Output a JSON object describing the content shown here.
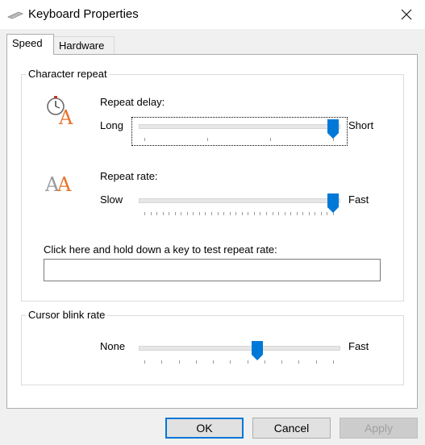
{
  "window": {
    "title": "Keyboard Properties"
  },
  "tabs": [
    {
      "label": "Speed",
      "active": true
    },
    {
      "label": "Hardware",
      "active": false
    }
  ],
  "character_repeat": {
    "group_label": "Character repeat",
    "repeat_delay": {
      "label": "Repeat delay:",
      "min_label": "Long",
      "max_label": "Short",
      "value_fraction": 1.0,
      "tick_count": 4
    },
    "repeat_rate": {
      "label": "Repeat rate:",
      "min_label": "Slow",
      "max_label": "Fast",
      "value_fraction": 1.0,
      "tick_count": 32
    },
    "test_prompt": "Click here and hold down a key to test repeat rate:",
    "test_input_value": ""
  },
  "cursor_blink": {
    "group_label": "Cursor blink rate",
    "min_label": "None",
    "max_label": "Fast",
    "value_fraction": 0.6,
    "tick_count": 12
  },
  "buttons": {
    "ok": "OK",
    "cancel": "Cancel",
    "apply": "Apply"
  },
  "colors": {
    "accent": "#0078d7",
    "thumb": "#0078d7",
    "window_bg": "#f0f0f0",
    "panel_bg": "#ffffff"
  },
  "icons": {
    "title": "keyboard-icon",
    "close": "close-icon",
    "repeat_delay": "stopwatch-letter-a-icon",
    "repeat_rate": "double-letter-a-icon"
  }
}
